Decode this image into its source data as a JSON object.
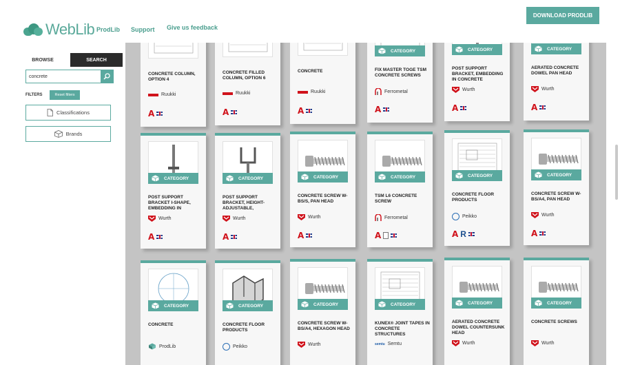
{
  "header": {
    "logo_text": "WebLib",
    "nav": [
      "ProdLib",
      "Support",
      "Give us feedback"
    ],
    "download_label": "DOWNLOAD PRODLIB"
  },
  "sidebar": {
    "tab_browse": "BROWSE",
    "tab_search": "SEARCH",
    "search_value": "concrete",
    "filters_label": "FILTERS",
    "reset_label": "Reset filters",
    "classifications_label": "Classifications",
    "brands_label": "Brands"
  },
  "category_label": "CATEGORY",
  "colors": {
    "accent": "#5aa99f",
    "dark_tab": "#2b2b2b",
    "brand_red": "#d0121b",
    "content_bg": "#c4c4c4"
  },
  "cards": [
    {
      "title": "CONCRETE COLUMN, OPTION 4",
      "brand": "Ruukki",
      "brand_icon": "ruukki-logo",
      "icons": [
        "autocad",
        "uk-flag"
      ],
      "thumb": "column-drawing"
    },
    {
      "title": "CONCRETE FILLED COLUMN, OPTION 6",
      "brand": "Ruukki",
      "brand_icon": "ruukki-logo",
      "icons": [
        "autocad",
        "uk-flag"
      ],
      "thumb": "column-drawing"
    },
    {
      "title": "CONCRETE",
      "brand": "Ruukki",
      "brand_icon": "ruukki-logo",
      "icons": [
        "autocad",
        "uk-flag"
      ],
      "thumb": "column-drawing"
    },
    {
      "title": "FIX MASTER TOGE TSM CONCRETE SCREWS",
      "brand": "Ferrometal",
      "brand_icon": "ferrometal-logo",
      "icons": [
        "autocad",
        "uk-flag"
      ],
      "thumb": "drawing",
      "category": true
    },
    {
      "title": "POST SUPPORT BRACKET, EMBEDDING IN CONCRETE",
      "brand": "Wurth",
      "brand_icon": "wurth-logo",
      "icons": [
        "autocad",
        "uk-flag"
      ],
      "thumb": "post",
      "category": true
    },
    {
      "title": "AERATED CONCRETE DOWEL PAN HEAD",
      "brand": "Wurth",
      "brand_icon": "wurth-logo",
      "icons": [
        "autocad",
        "uk-flag"
      ],
      "thumb": "screw",
      "category": true
    },
    {
      "title": "POST SUPPORT BRACKET I-SHAPE, EMBEDDING IN",
      "brand": "Wurth",
      "brand_icon": "wurth-logo",
      "icons": [
        "autocad",
        "uk-flag"
      ],
      "thumb": "post",
      "category": true
    },
    {
      "title": "POST SUPPORT BRACKET, HEIGHT-ADJUSTABLE,",
      "brand": "Wurth",
      "brand_icon": "wurth-logo",
      "icons": [
        "autocad",
        "uk-flag"
      ],
      "thumb": "u-bracket",
      "category": true
    },
    {
      "title": "CONCRETE SCREW W-BS/S, PAN HEAD",
      "brand": "Wurth",
      "brand_icon": "wurth-logo",
      "icons": [
        "autocad",
        "uk-flag"
      ],
      "thumb": "screw",
      "category": true
    },
    {
      "title": "TSM L6 CONCRETE SCREW",
      "brand": "Ferrometal",
      "brand_icon": "ferrometal-logo",
      "icons": [
        "autocad",
        "document",
        "uk-flag"
      ],
      "thumb": "screw",
      "category": true
    },
    {
      "title": "CONCRETE FLOOR PRODUCTS",
      "brand": "Peikko",
      "brand_icon": "peikko-logo",
      "icons": [
        "autocad",
        "revit",
        "uk-flag"
      ],
      "thumb": "drawing",
      "category": true
    },
    {
      "title": "CONCRETE SCREW W-BS/A4, PAN HEAD",
      "brand": "Wurth",
      "brand_icon": "wurth-logo",
      "icons": [
        "autocad",
        "uk-flag"
      ],
      "thumb": "screw",
      "category": true
    },
    {
      "title": "CONCRETE",
      "brand": "ProdLib",
      "brand_icon": "prodlib-logo",
      "icons": [],
      "thumb": "circle",
      "category": true
    },
    {
      "title": "CONCRETE FLOOR PRODUCTS",
      "brand": "Peikko",
      "brand_icon": "peikko-logo",
      "icons": [],
      "thumb": "block",
      "category": true
    },
    {
      "title": "CONCRETE SCREW W-BS/A4, HEXAGON HEAD",
      "brand": "Wurth",
      "brand_icon": "wurth-logo",
      "icons": [],
      "thumb": "screw",
      "category": true
    },
    {
      "title": "KUNEX® JOINT TAPES IN CONCRETE STRUCTURES",
      "brand": "Semtu",
      "brand_icon": "semtu-logo",
      "icons": [],
      "thumb": "drawing",
      "category": true
    },
    {
      "title": "AERATED CONCRETE DOWEL COUNTERSUNK HEAD",
      "brand": "Wurth",
      "brand_icon": "wurth-logo",
      "icons": [],
      "thumb": "screw",
      "category": true
    },
    {
      "title": "CONCRETE SCREWS",
      "brand": "Wurth",
      "brand_icon": "wurth-logo",
      "icons": [],
      "thumb": "screw",
      "category": true
    }
  ]
}
